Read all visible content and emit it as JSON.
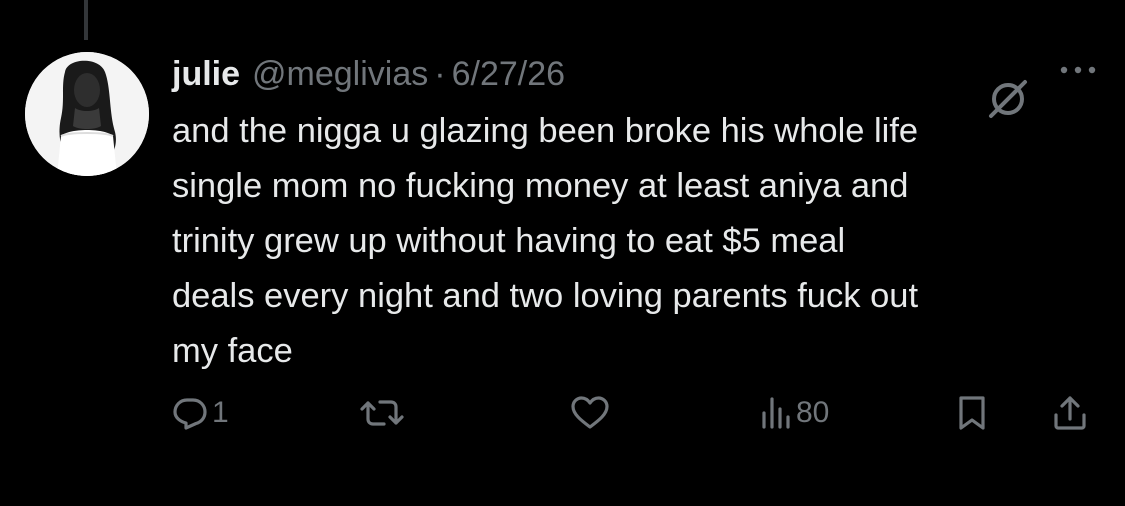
{
  "tweet": {
    "display_name": "julie",
    "handle": "@meglivias",
    "separator": "·",
    "date": "6/27/26",
    "text": "and the nigga u glazing been broke his whole life\nsingle mom no fucking money at least aniya and\ntrinity grew up without having to eat $5 meal\ndeals every night and two loving parents fuck out\nmy face"
  },
  "actions": {
    "reply_count": "1",
    "retweet_count": "",
    "like_count": "",
    "views_count": "80"
  },
  "icons": {
    "avatar": "profile-photo",
    "grok": "grok-icon",
    "more": "more-icon",
    "reply": "reply-icon",
    "retweet": "retweet-icon",
    "like": "like-icon",
    "views": "views-icon",
    "bookmark": "bookmark-icon",
    "share": "share-icon"
  },
  "colors": {
    "background": "#000000",
    "primary_text": "#e7e9ea",
    "secondary_text": "#71767b",
    "thread_line": "#333639"
  }
}
